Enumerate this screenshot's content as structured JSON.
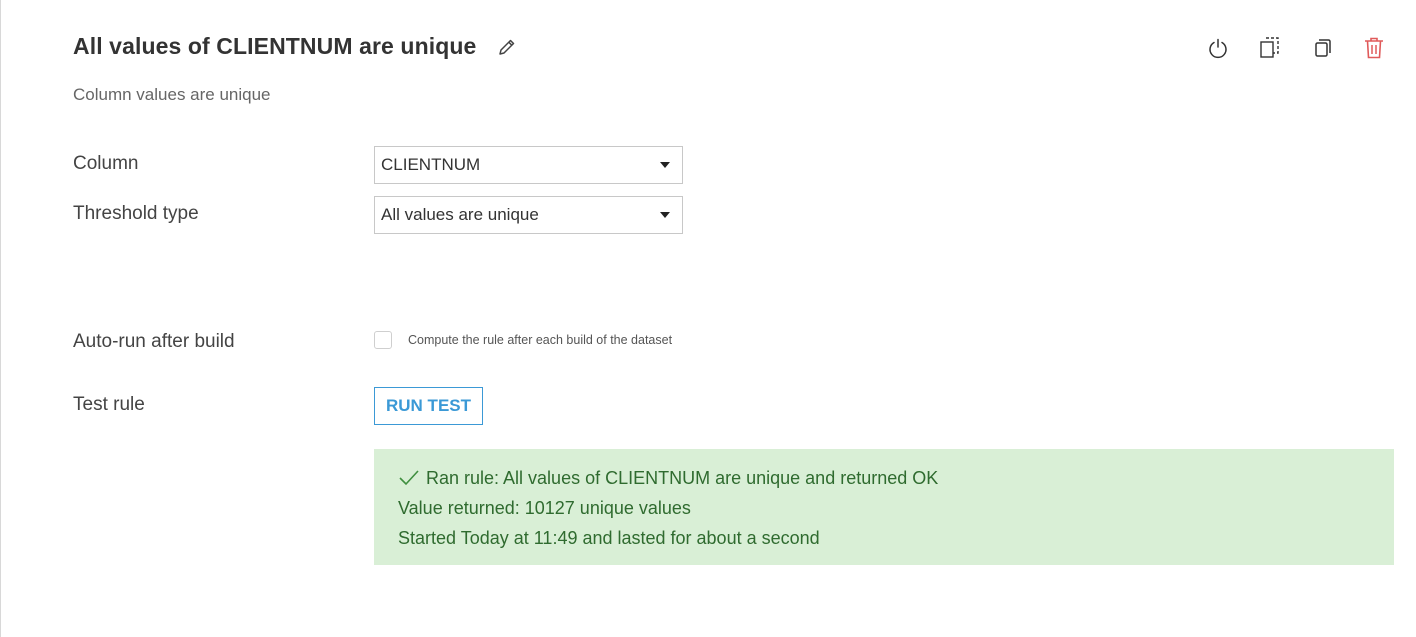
{
  "header": {
    "title": "All values of CLIENTNUM are unique",
    "subtitle": "Column values are unique"
  },
  "actions": [
    {
      "icon": "power-icon"
    },
    {
      "icon": "duplicate-icon"
    },
    {
      "icon": "copy-icon"
    },
    {
      "icon": "trash-icon"
    }
  ],
  "form": {
    "column_label": "Column",
    "column_value": "CLIENTNUM",
    "threshold_label": "Threshold type",
    "threshold_value": "All values are unique",
    "autorun_label": "Auto-run after build",
    "autorun_checkbox_label": "Compute the rule after each build of the dataset",
    "autorun_checked": false,
    "test_label": "Test rule",
    "run_button": "RUN TEST"
  },
  "result": {
    "line1": "Ran rule: All values of CLIENTNUM are unique and returned OK",
    "line2": "Value returned: 10127 unique values",
    "line3": "Started Today at 11:49 and lasted for about a second"
  },
  "colors": {
    "accent": "#3b99d6",
    "success_bg": "#d9efd6",
    "success_text": "#2f6b2f",
    "danger": "#e05a5a"
  }
}
